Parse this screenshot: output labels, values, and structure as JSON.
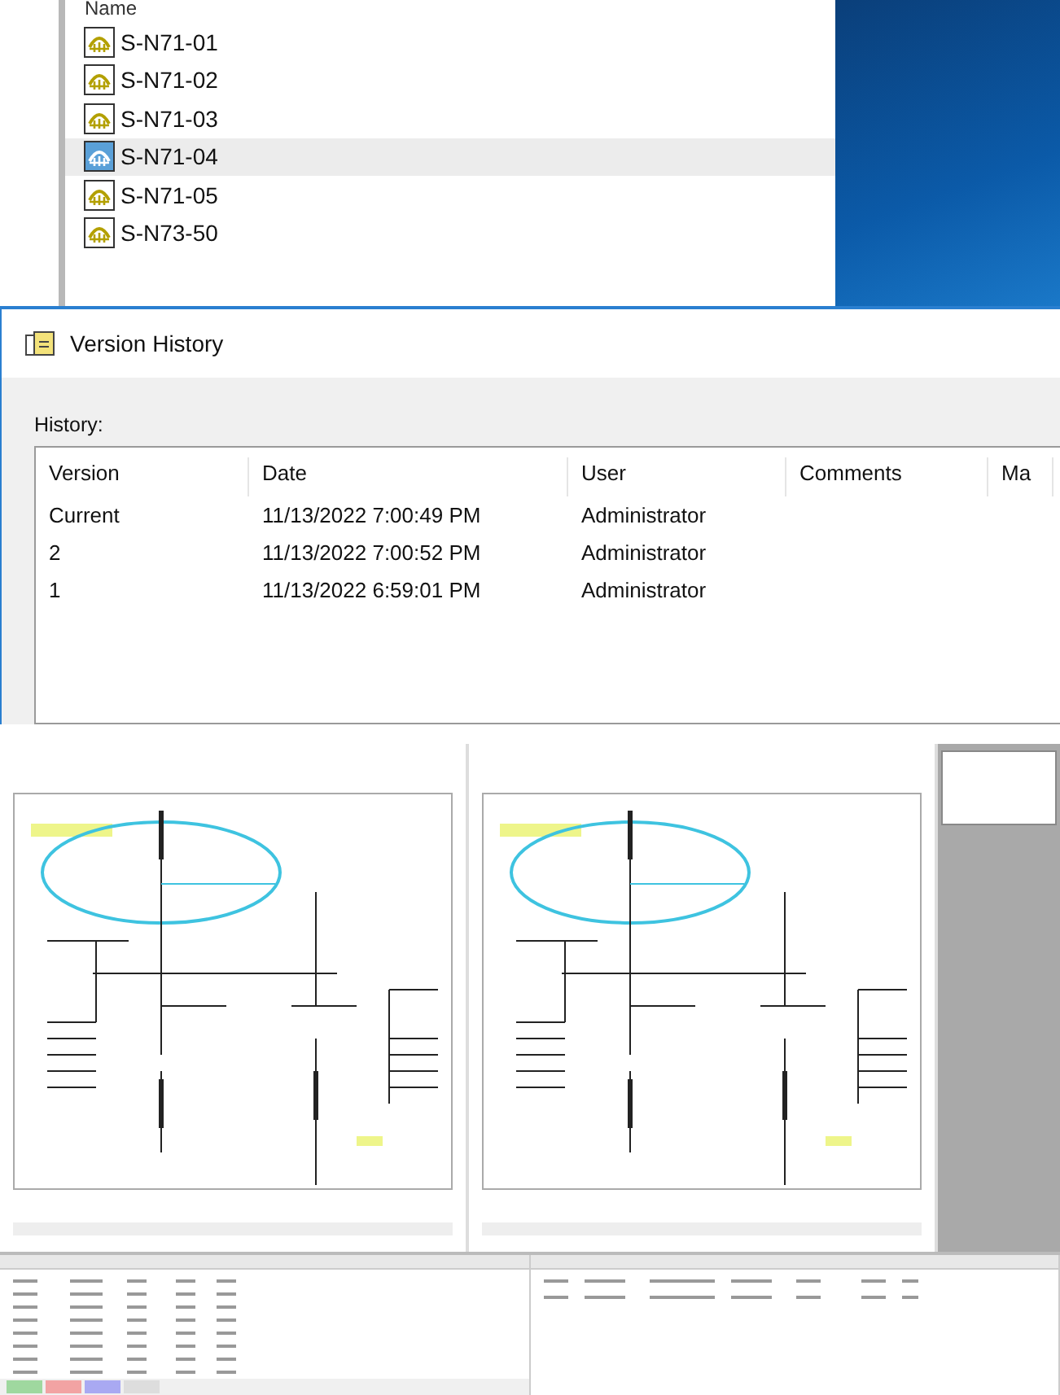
{
  "file_list": {
    "header": "Name",
    "items": [
      {
        "name": "S-N71-01",
        "selected": false
      },
      {
        "name": "S-N71-02",
        "selected": false
      },
      {
        "name": "S-N71-03",
        "selected": false
      },
      {
        "name": "S-N71-04",
        "selected": true
      },
      {
        "name": "S-N71-05",
        "selected": false
      },
      {
        "name": "S-N73-50",
        "selected": false
      }
    ]
  },
  "version_history": {
    "title": "Version History",
    "history_label": "History:",
    "columns": [
      "Version",
      "Date",
      "User",
      "Comments",
      "Ma"
    ],
    "rows": [
      [
        "Current",
        "11/13/2022 7:00:49 PM",
        "Administrator"
      ],
      [
        "2",
        "11/13/2022 7:00:52 PM",
        "Administrator"
      ],
      [
        "1",
        "11/13/2022 6:59:01 PM",
        "Administrator"
      ]
    ]
  }
}
